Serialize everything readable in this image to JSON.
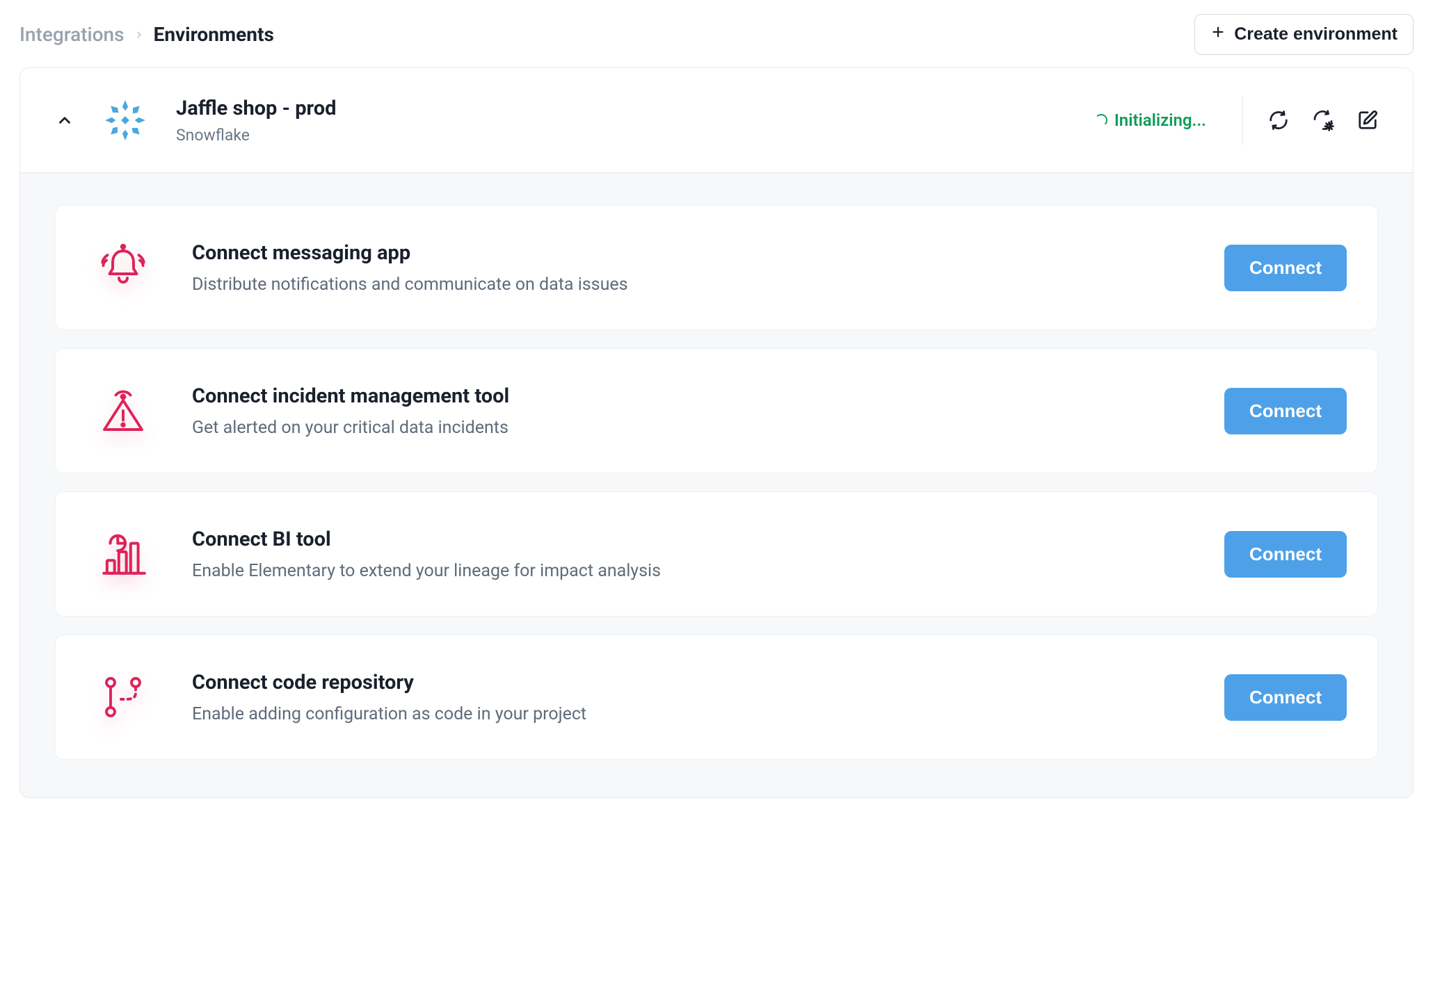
{
  "breadcrumb": {
    "prev": "Integrations",
    "current": "Environments"
  },
  "header": {
    "create_button": "Create environment"
  },
  "environment": {
    "title": "Jaffle shop - prod",
    "subtitle": "Snowflake",
    "status": "Initializing...",
    "actions": {
      "sync": "sync-icon",
      "settings": "sync-settings-icon",
      "edit": "edit-icon"
    }
  },
  "cards": [
    {
      "icon": "bell-alert-icon",
      "title": "Connect messaging app",
      "desc": "Distribute notifications and communicate on data issues",
      "button": "Connect"
    },
    {
      "icon": "warning-signal-icon",
      "title": "Connect incident management tool",
      "desc": "Get alerted on your critical data incidents",
      "button": "Connect"
    },
    {
      "icon": "analytics-chart-icon",
      "title": "Connect BI tool",
      "desc": "Enable Elementary to extend your lineage for impact analysis",
      "button": "Connect"
    },
    {
      "icon": "git-branch-icon",
      "title": "Connect code repository",
      "desc": "Enable adding configuration as code in your project",
      "button": "Connect"
    }
  ]
}
